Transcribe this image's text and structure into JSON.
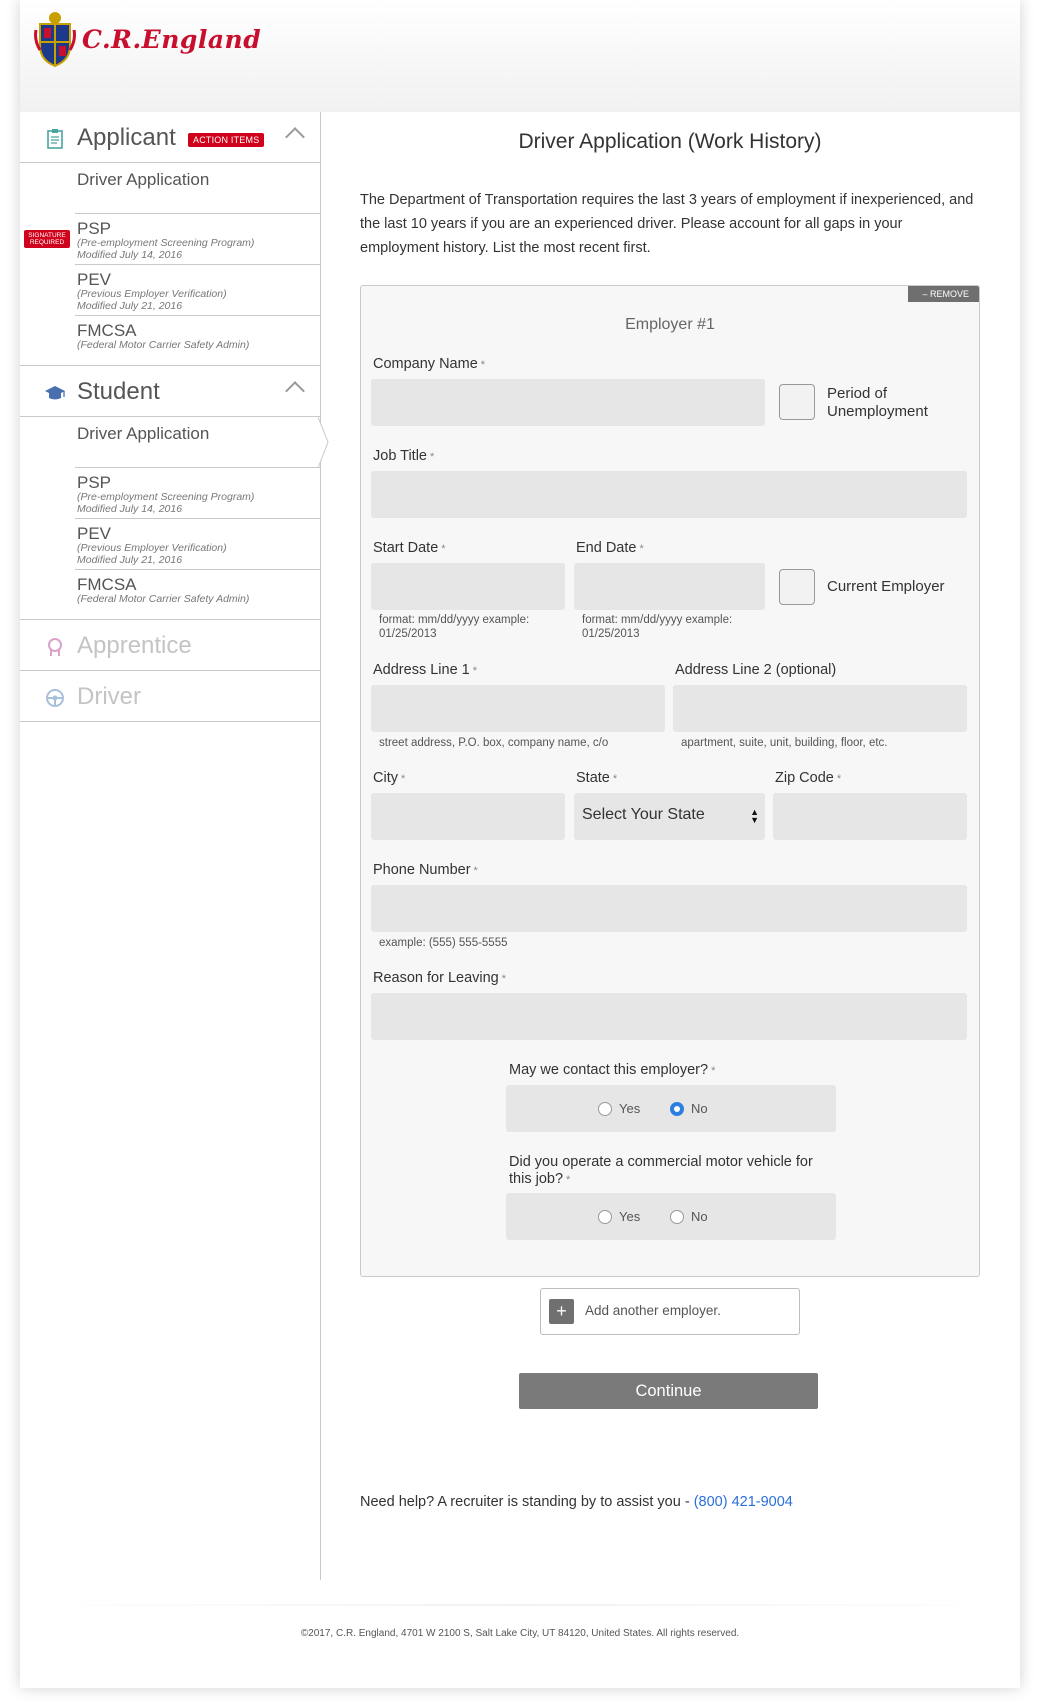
{
  "brand": {
    "name": "C.R.England"
  },
  "sidebar": {
    "applicant": {
      "title": "Applicant",
      "badge": "ACTION ITEMS",
      "items": [
        {
          "title": "Driver Application"
        },
        {
          "title": "PSP",
          "subtitle": "(Pre-employment Screening Program)",
          "modified": "Modified July 14, 2016",
          "badge": "SIGNATURE REQUIRED"
        },
        {
          "title": "PEV",
          "subtitle": "(Previous Employer Verification)",
          "modified": "Modified July 21, 2016"
        },
        {
          "title": "FMCSA",
          "subtitle": "(Federal Motor Carrier Safety Admin)"
        }
      ]
    },
    "student": {
      "title": "Student",
      "items": [
        {
          "title": "Driver Application"
        },
        {
          "title": "PSP",
          "subtitle": "(Pre-employment Screening Program)",
          "modified": "Modified July 14, 2016"
        },
        {
          "title": "PEV",
          "subtitle": "(Previous Employer Verification)",
          "modified": "Modified July 21, 2016"
        },
        {
          "title": "FMCSA",
          "subtitle": "(Federal Motor Carrier Safety Admin)"
        }
      ]
    },
    "apprentice": {
      "title": "Apprentice"
    },
    "driver": {
      "title": "Driver"
    }
  },
  "main": {
    "title": "Driver Application (Work History)",
    "intro": "The Department of Transportation requires the last 3 years of employment if inexperienced, and the last 10 years if you are an experienced driver. Please account for all gaps in your employment history. List the most recent first.",
    "employer": {
      "title": "Employer #1",
      "remove": "– REMOVE",
      "company_label": "Company Name",
      "unemployment_label": "Period of Unemployment",
      "job_title_label": "Job Title",
      "start_label": "Start Date",
      "end_label": "End Date",
      "date_help": "format: mm/dd/yyyy     example: 01/25/2013",
      "current_label": "Current Employer",
      "addr1_label": "Address Line 1",
      "addr1_help": "street address, P.O. box, company name, c/o",
      "addr2_label": "Address Line 2 (optional)",
      "addr2_help": "apartment, suite, unit, building, floor, etc.",
      "city_label": "City",
      "state_label": "State",
      "state_value": "Select Your State",
      "zip_label": "Zip Code",
      "phone_label": "Phone Number",
      "phone_help": "example: (555) 555-5555",
      "reason_label": "Reason for Leaving",
      "contact_label": "May we contact this employer?",
      "contact_value": "No",
      "cmv_label": "Did you operate a commercial motor vehicle for this job?",
      "yes": "Yes",
      "no": "No",
      "required_mark": "*"
    },
    "add_employer": "Add another employer.",
    "continue": "Continue",
    "help_text": "Need help? A recruiter is standing by to assist you - ",
    "help_phone": "(800) 421-9004"
  },
  "footer": {
    "text": "©2017, C.R. England, 4701 W 2100 S, Salt Lake City, UT 84120, United States. All rights reserved."
  },
  "colors": {
    "brand_red": "#c8102e",
    "action_red": "#d0021b",
    "link_blue": "#2a6fdb"
  }
}
